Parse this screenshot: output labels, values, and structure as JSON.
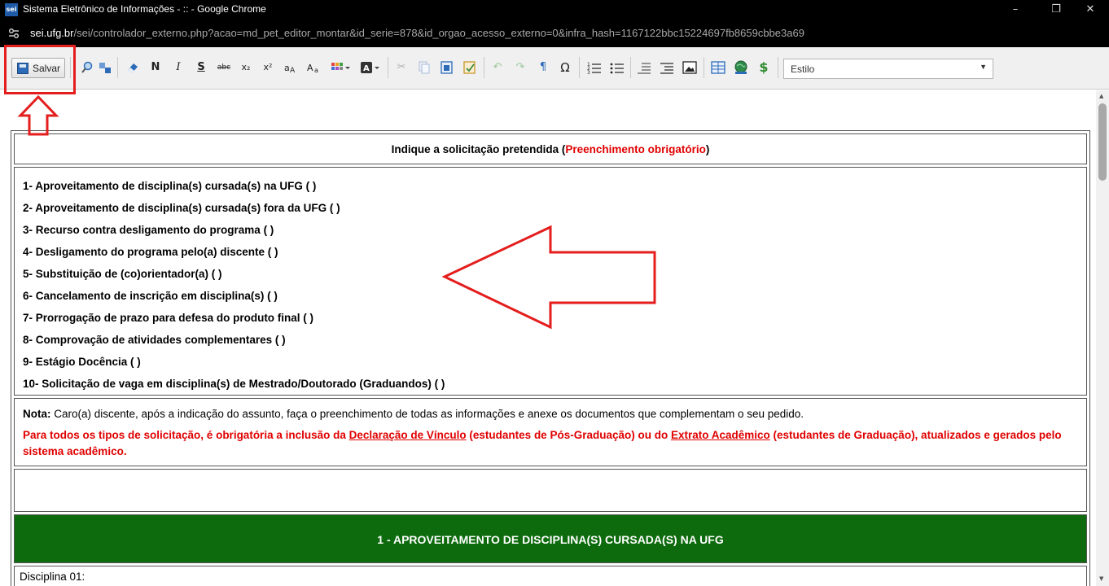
{
  "window": {
    "logo": "sei",
    "title": "Sistema Eletrônico de Informações - :: - Google Chrome",
    "minimize_glyph": "–",
    "restore_glyph": "❐",
    "close_glyph": "✕"
  },
  "address": {
    "domain": "sei.ufg.br",
    "path": "/sei/controlador_externo.php?acao=md_pet_editor_montar&id_serie=878&id_orgao_acesso_externo=0&infra_hash=1167122bbc15224697fb8659cbbe3a69"
  },
  "toolbar": {
    "save_label": "Salvar",
    "bold_glyph": "N",
    "italic_glyph": "I",
    "underline_glyph": "S",
    "strike_glyph": "abc",
    "subscript_glyph": "x₂",
    "superscript_glyph": "x²",
    "omega_glyph": "Ω",
    "pilcrow_glyph": "¶",
    "dollar_glyph": "$",
    "style_value": "Estilo"
  },
  "document": {
    "header_prefix": "Indique a solicitação pretendida (",
    "header_required": "Preenchimento obrigatório",
    "header_suffix": ")",
    "options": [
      "1- Aproveitamento de disciplina(s) cursada(s) na UFG (     )",
      "2- Aproveitamento de disciplina(s) cursada(s) fora da UFG (     )",
      "3- Recurso contra desligamento do programa (     )",
      "4- Desligamento do programa pelo(a) discente (     )",
      "5- Substituição de (co)orientador(a) (     )",
      "6- Cancelamento de inscrição em disciplina(s) (     )",
      "7- Prorrogação de prazo para defesa do produto final (     )",
      "8- Comprovação de atividades complementares (     )",
      "9- Estágio Docência (     )",
      "10- Solicitação de vaga em disciplina(s) de Mestrado/Doutorado (Graduandos) (   )"
    ],
    "note_label": "Nota:",
    "note_text": " Caro(a) discente, após a indicação do assunto, faça o preenchimento de todas as informações e anexe os documentos que complementam o seu pedido.",
    "req_part1": "Para todos os tipos de solicitação, é obrigatória a inclusão da ",
    "req_link1": "Declaração de Vínculo",
    "req_part2": " (estudantes de Pós-Graduação) ou do ",
    "req_link2": "Extrato Acadêmico",
    "req_part3": " (estudantes de Graduação), atualizados e gerados pelo sistema acadêmico.",
    "section_title": "1 - APROVEITAMENTO DE DISCIPLINA(S) CURSADA(S) NA UFG",
    "discipline_label": "Disciplina 01:"
  },
  "colors": {
    "annotation": "#e41d1d",
    "required_text": "#e00000",
    "section_bg": "#0d6a0d"
  }
}
